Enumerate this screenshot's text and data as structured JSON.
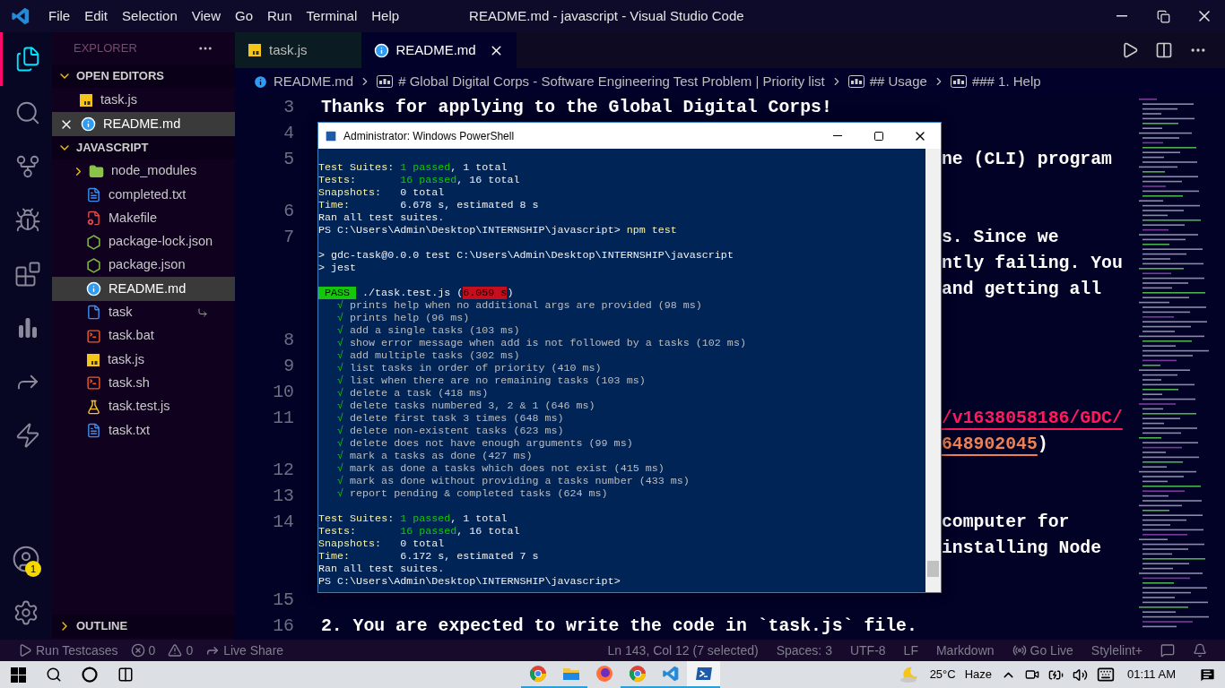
{
  "title_bar": {
    "menu": [
      "File",
      "Edit",
      "Selection",
      "View",
      "Go",
      "Run",
      "Terminal",
      "Help"
    ],
    "title": "README.md - javascript - Visual Studio Code"
  },
  "activity_bar": {
    "items": [
      {
        "kind": "files",
        "selected": true
      },
      {
        "kind": "search",
        "selected": false
      },
      {
        "kind": "source-control",
        "selected": false
      },
      {
        "kind": "debug",
        "selected": false
      },
      {
        "kind": "extensions",
        "selected": false
      },
      {
        "kind": "chart",
        "selected": false
      },
      {
        "kind": "live-share",
        "selected": false
      },
      {
        "kind": "lightning",
        "selected": false
      }
    ],
    "account_badge": "1"
  },
  "sidebar": {
    "title": "EXPLORER",
    "open_editors": {
      "label": "OPEN EDITORS",
      "expanded": true,
      "items": [
        {
          "name": "task.js",
          "kind": "js",
          "selected": false
        },
        {
          "name": "README.md",
          "kind": "info",
          "selected": true
        }
      ]
    },
    "folder": {
      "label": "JAVASCRIPT",
      "expanded": true,
      "items": [
        {
          "name": "node_modules",
          "kind": "folder",
          "selected": false,
          "linked": false
        },
        {
          "name": "completed.txt",
          "kind": "txt",
          "selected": false,
          "linked": false
        },
        {
          "name": "Makefile",
          "kind": "make",
          "selected": false,
          "linked": false
        },
        {
          "name": "package-lock.json",
          "kind": "node",
          "selected": false,
          "linked": false
        },
        {
          "name": "package.json",
          "kind": "node",
          "selected": false,
          "linked": false
        },
        {
          "name": "README.md",
          "kind": "info",
          "selected": true,
          "linked": false
        },
        {
          "name": "task",
          "kind": "file",
          "selected": false,
          "linked": true
        },
        {
          "name": "task.bat",
          "kind": "shell",
          "selected": false,
          "linked": false
        },
        {
          "name": "task.js",
          "kind": "js",
          "selected": false,
          "linked": false
        },
        {
          "name": "task.sh",
          "kind": "shell",
          "selected": false,
          "linked": false
        },
        {
          "name": "task.test.js",
          "kind": "test",
          "selected": false,
          "linked": false
        },
        {
          "name": "task.txt",
          "kind": "txt",
          "selected": false,
          "linked": false
        }
      ]
    },
    "outline": {
      "label": "OUTLINE",
      "expanded": false
    }
  },
  "tabs": [
    {
      "label": "task.js",
      "kind": "js",
      "selected": false
    },
    {
      "label": "README.md",
      "kind": "info",
      "selected": true
    }
  ],
  "breadcrumb": [
    {
      "text": "README.md",
      "kind": "file"
    },
    {
      "text": "# Global Digital Corps - Software Engineering Test Problem | Priority list",
      "kind": "heading"
    },
    {
      "text": "## Usage",
      "kind": "heading"
    },
    {
      "text": "### 1. Help",
      "kind": "heading"
    }
  ],
  "editor": {
    "lines": [
      {
        "number": "3",
        "rows": [
          {
            "covered": false,
            "segments": [
              {
                "text": "Thanks for applying to the Global Digital Corps!",
                "kind": "plain"
              }
            ]
          }
        ]
      },
      {
        "number": "4"
      },
      {
        "number": "5",
        "rows": [
          {
            "covered": true,
            "segments": [
              {
                "text": "ne (CLI) program",
                "kind": "plain"
              }
            ]
          },
          {
            "covered": true
          }
        ]
      },
      {
        "number": "6"
      },
      {
        "number": "7",
        "rows": [
          {
            "covered": true,
            "segments": [
              {
                "text": "s. Since we",
                "kind": "plain"
              }
            ]
          },
          {
            "covered": true,
            "segments": [
              {
                "text": "ntly failing. You",
                "kind": "plain"
              }
            ]
          },
          {
            "covered": true,
            "segments": [
              {
                "text": "and getting all",
                "kind": "plain"
              }
            ]
          },
          {
            "covered": true
          }
        ]
      },
      {
        "number": "8"
      },
      {
        "number": "9"
      },
      {
        "number": "10"
      },
      {
        "number": "11",
        "rows": [
          {
            "covered": true,
            "segments": [
              {
                "text": "/v1638058186/GDC/",
                "kind": "link"
              }
            ]
          },
          {
            "covered": true,
            "segments": [
              {
                "text": "648902045",
                "kind": "link-number"
              },
              {
                "text": ")",
                "kind": "plain"
              }
            ]
          }
        ]
      },
      {
        "number": "12"
      },
      {
        "number": "13"
      },
      {
        "number": "14",
        "rows": [
          {
            "covered": true,
            "segments": [
              {
                "text": "computer for",
                "kind": "plain"
              }
            ]
          },
          {
            "covered": true,
            "segments": [
              {
                "text": "installing Node",
                "kind": "plain"
              }
            ]
          },
          {
            "covered": true
          }
        ]
      },
      {
        "number": "15"
      },
      {
        "number": "16",
        "rows": [
          {
            "covered": false,
            "segments": [
              {
                "text": "2. You are expected to write the code in `task.js` file.",
                "kind": "plain"
              }
            ]
          }
        ]
      }
    ]
  },
  "powershell": {
    "title": "Administrator: Windows PowerShell",
    "lines": [
      {
        "kind": "text",
        "segments": [
          {
            "text": "Test Suites:",
            "kind": "label"
          },
          {
            "text": "1 passed",
            "kind": "pass"
          },
          {
            "text": ", 1 total",
            "kind": "plain"
          }
        ]
      },
      {
        "kind": "text",
        "segments": [
          {
            "text": "Tests:",
            "kind": "label"
          },
          {
            "text": "16 passed",
            "kind": "pass"
          },
          {
            "text": ", 16 total",
            "kind": "plain"
          }
        ]
      },
      {
        "kind": "text",
        "segments": [
          {
            "text": "Snapshots:",
            "kind": "label"
          },
          {
            "text": "0 total",
            "kind": "plain"
          }
        ]
      },
      {
        "kind": "text",
        "segments": [
          {
            "text": "Time:",
            "kind": "label"
          },
          {
            "text": "6.678 s, estimated 8 s",
            "kind": "plain"
          }
        ]
      },
      {
        "kind": "text",
        "segments": [
          {
            "text": "Ran all test suites.",
            "kind": "plain"
          }
        ]
      },
      {
        "kind": "text",
        "segments": [
          {
            "text": "PS C:\\Users\\Admin\\Desktop\\INTERNSHIP\\javascript>",
            "kind": "plain"
          },
          {
            "text": "npm test",
            "kind": "command"
          }
        ]
      },
      {
        "kind": "blank"
      },
      {
        "kind": "text",
        "segments": [
          {
            "text": "> gdc-task@0.0.0 test C:\\Users\\Admin\\Desktop\\INTERNSHIP\\javascript",
            "kind": "plain"
          }
        ]
      },
      {
        "kind": "text",
        "segments": [
          {
            "text": "> jest",
            "kind": "plain"
          }
        ]
      },
      {
        "kind": "blank"
      },
      {
        "kind": "text",
        "segments": [
          {
            "text": "PASS",
            "kind": "badge-pass"
          },
          {
            "text": "./task.test.js (",
            "kind": "plain"
          },
          {
            "text": "6.059 s",
            "kind": "badge-slow"
          },
          {
            "text": ")",
            "kind": "plain"
          }
        ]
      },
      {
        "kind": "test",
        "segments": [
          {
            "text": "√",
            "kind": "check"
          },
          {
            "text": "prints help when no additional args are provided (98 ms)",
            "kind": "muted"
          }
        ]
      },
      {
        "kind": "test",
        "segments": [
          {
            "text": "√",
            "kind": "check"
          },
          {
            "text": "prints help (96 ms)",
            "kind": "muted"
          }
        ]
      },
      {
        "kind": "test",
        "segments": [
          {
            "text": "√",
            "kind": "check"
          },
          {
            "text": "add a single tasks (103 ms)",
            "kind": "muted"
          }
        ]
      },
      {
        "kind": "test",
        "segments": [
          {
            "text": "√",
            "kind": "check"
          },
          {
            "text": "show error message when add is not followed by a tasks (102 ms)",
            "kind": "muted"
          }
        ]
      },
      {
        "kind": "test",
        "segments": [
          {
            "text": "√",
            "kind": "check"
          },
          {
            "text": "add multiple tasks (302 ms)",
            "kind": "muted"
          }
        ]
      },
      {
        "kind": "test",
        "segments": [
          {
            "text": "√",
            "kind": "check"
          },
          {
            "text": "list tasks in order of priority (410 ms)",
            "kind": "muted"
          }
        ]
      },
      {
        "kind": "test",
        "segments": [
          {
            "text": "√",
            "kind": "check"
          },
          {
            "text": "list when there are no remaining tasks (103 ms)",
            "kind": "muted"
          }
        ]
      },
      {
        "kind": "test",
        "segments": [
          {
            "text": "√",
            "kind": "check"
          },
          {
            "text": "delete a task (418 ms)",
            "kind": "muted"
          }
        ]
      },
      {
        "kind": "test",
        "segments": [
          {
            "text": "√",
            "kind": "check"
          },
          {
            "text": "delete tasks numbered 3, 2 & 1 (646 ms)",
            "kind": "muted"
          }
        ]
      },
      {
        "kind": "test",
        "segments": [
          {
            "text": "√",
            "kind": "check"
          },
          {
            "text": "delete first task 3 times (648 ms)",
            "kind": "muted"
          }
        ]
      },
      {
        "kind": "test",
        "segments": [
          {
            "text": "√",
            "kind": "check"
          },
          {
            "text": "delete non-existent tasks (623 ms)",
            "kind": "muted"
          }
        ]
      },
      {
        "kind": "test",
        "segments": [
          {
            "text": "√",
            "kind": "check"
          },
          {
            "text": "delete does not have enough arguments (99 ms)",
            "kind": "muted"
          }
        ]
      },
      {
        "kind": "test",
        "segments": [
          {
            "text": "√",
            "kind": "check"
          },
          {
            "text": "mark a tasks as done (427 ms)",
            "kind": "muted"
          }
        ]
      },
      {
        "kind": "test",
        "segments": [
          {
            "text": "√",
            "kind": "check"
          },
          {
            "text": "mark as done a tasks which does not exist (415 ms)",
            "kind": "muted"
          }
        ]
      },
      {
        "kind": "test",
        "segments": [
          {
            "text": "√",
            "kind": "check"
          },
          {
            "text": "mark as done without providing a tasks number (433 ms)",
            "kind": "muted"
          }
        ]
      },
      {
        "kind": "test",
        "segments": [
          {
            "text": "√",
            "kind": "check"
          },
          {
            "text": "report pending & completed tasks (624 ms)",
            "kind": "muted"
          }
        ]
      },
      {
        "kind": "blank"
      },
      {
        "kind": "text",
        "segments": [
          {
            "text": "Test Suites:",
            "kind": "label"
          },
          {
            "text": "1 passed",
            "kind": "pass"
          },
          {
            "text": ", 1 total",
            "kind": "plain"
          }
        ]
      },
      {
        "kind": "text",
        "segments": [
          {
            "text": "Tests:",
            "kind": "label"
          },
          {
            "text": "16 passed",
            "kind": "pass"
          },
          {
            "text": ", 16 total",
            "kind": "plain"
          }
        ]
      },
      {
        "kind": "text",
        "segments": [
          {
            "text": "Snapshots:",
            "kind": "label"
          },
          {
            "text": "0 total",
            "kind": "plain"
          }
        ]
      },
      {
        "kind": "text",
        "segments": [
          {
            "text": "Time:",
            "kind": "label"
          },
          {
            "text": "6.172 s, estimated 7 s",
            "kind": "plain"
          }
        ]
      },
      {
        "kind": "text",
        "segments": [
          {
            "text": "Ran all test suites.",
            "kind": "plain"
          }
        ]
      },
      {
        "kind": "text",
        "segments": [
          {
            "text": "PS C:\\Users\\Admin\\Desktop\\INTERNSHIP\\javascript>",
            "kind": "plain"
          }
        ]
      }
    ]
  },
  "status_bar": {
    "left": [
      {
        "kind": "run",
        "text": "Run Testcases"
      },
      {
        "kind": "errors",
        "text": "0"
      },
      {
        "kind": "warnings",
        "text": "0"
      },
      {
        "kind": "live-share",
        "text": "Live Share"
      }
    ],
    "right": [
      {
        "kind": "text",
        "text": "Ln 143, Col 12 (7 selected)"
      },
      {
        "kind": "text",
        "text": "Spaces: 3"
      },
      {
        "kind": "text",
        "text": "UTF-8"
      },
      {
        "kind": "text",
        "text": "LF"
      },
      {
        "kind": "text",
        "text": "Markdown"
      },
      {
        "kind": "go-live",
        "text": "Go Live"
      },
      {
        "kind": "text",
        "text": "Stylelint+"
      },
      {
        "kind": "feedback"
      },
      {
        "kind": "bell"
      }
    ]
  },
  "taskbar": {
    "apps": [
      {
        "kind": "browser",
        "running": true,
        "selected": false
      },
      {
        "kind": "folder",
        "running": true,
        "selected": false
      },
      {
        "kind": "fox",
        "running": false,
        "selected": false
      },
      {
        "kind": "browser",
        "running": true,
        "selected": false
      },
      {
        "kind": "editor",
        "running": true,
        "selected": false
      },
      {
        "kind": "terminal",
        "running": true,
        "selected": true
      }
    ],
    "temperature": "25°C",
    "weather": "Haze",
    "time": "01:11 AM"
  }
}
